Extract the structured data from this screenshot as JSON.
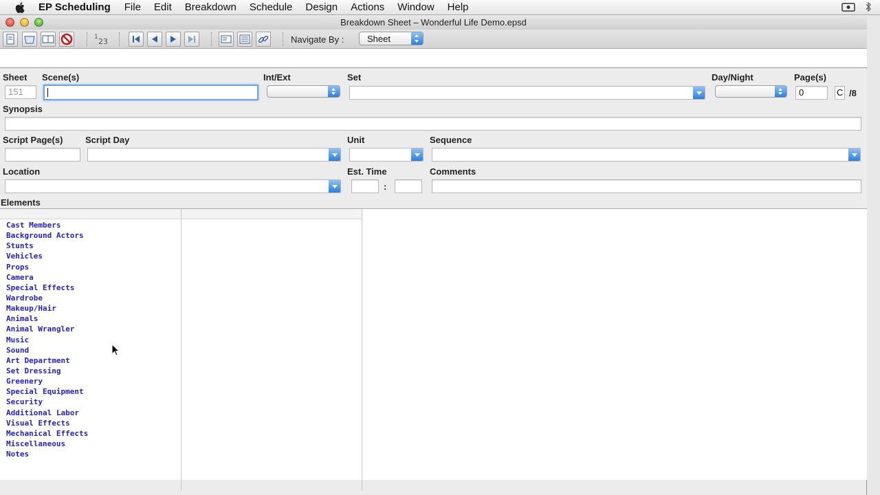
{
  "menubar": {
    "app_name": "EP Scheduling",
    "menus": [
      "File",
      "Edit",
      "Breakdown",
      "Schedule",
      "Design",
      "Actions",
      "Window",
      "Help"
    ]
  },
  "window": {
    "title": "Breakdown Sheet – Wonderful Life Demo.epsd"
  },
  "toolbar": {
    "navigate_label": "Navigate By :",
    "navigate_value": "Sheet"
  },
  "form": {
    "sheet_label": "Sheet",
    "sheet_value": "151",
    "scenes_label": "Scene(s)",
    "scenes_value": "",
    "intext_label": "Int/Ext",
    "set_label": "Set",
    "daynight_label": "Day/Night",
    "pages_label": "Page(s)",
    "pages_value": "0",
    "pages_fraction": "C",
    "pages_suffix": "/8",
    "synopsis_label": "Synopsis",
    "script_pages_label": "Script Page(s)",
    "script_day_label": "Script Day",
    "unit_label": "Unit",
    "sequence_label": "Sequence",
    "location_label": "Location",
    "est_time_label": "Est. Time",
    "est_time_sep": ":",
    "comments_label": "Comments"
  },
  "elements": {
    "header": "Elements",
    "items": [
      "Cast Members",
      "Background Actors",
      "Stunts",
      "Vehicles",
      "Props",
      "Camera",
      "Special Effects",
      "Wardrobe",
      "Makeup/Hair",
      "Animals",
      "Animal Wrangler",
      "Music",
      "Sound",
      "Art Department",
      "Set Dressing",
      "Greenery",
      "Special Equipment",
      "Security",
      "Additional Labor",
      "Visual Effects",
      "Mechanical Effects",
      "Miscellaneous",
      "Notes"
    ]
  },
  "colors": {
    "element_link": "#2222c8",
    "accent_blue": "#2f7fdb"
  }
}
